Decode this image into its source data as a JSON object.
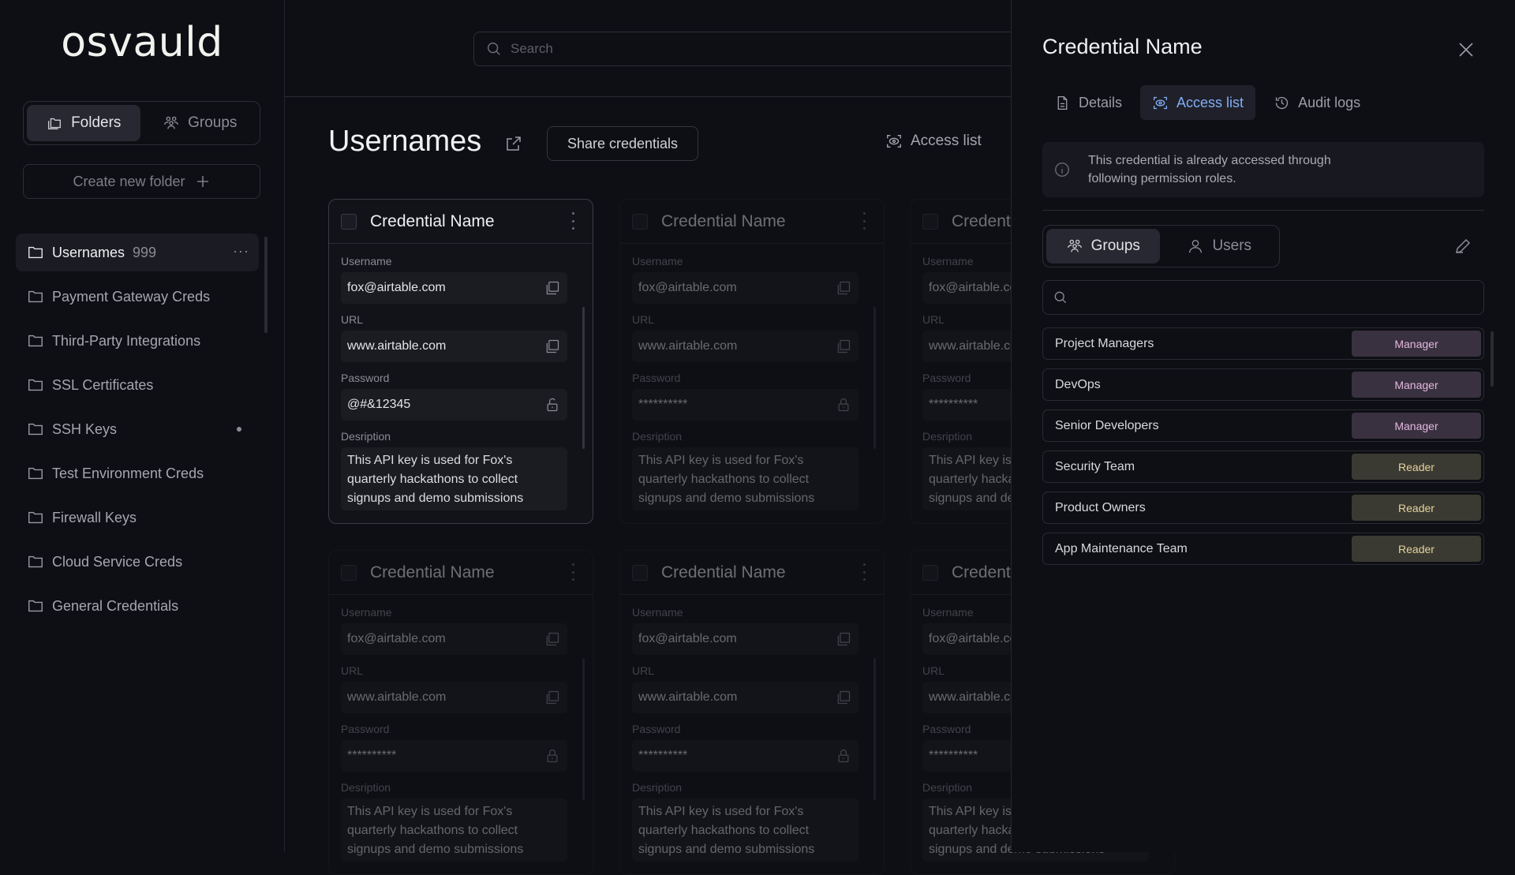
{
  "app": {
    "logo": "osvauld"
  },
  "sidebar": {
    "toggle": {
      "folders": "Folders",
      "groups": "Groups",
      "active": "folders"
    },
    "create_folder": "Create new folder",
    "folders": [
      {
        "name": "Usernames",
        "count": "999",
        "active": true,
        "more": "···"
      },
      {
        "name": "Payment Gateway Creds"
      },
      {
        "name": "Third-Party Integrations"
      },
      {
        "name": "SSL Certificates"
      },
      {
        "name": "SSH Keys",
        "indicator": true
      },
      {
        "name": "Test Environment Creds"
      },
      {
        "name": "Firewall Keys"
      },
      {
        "name": "Cloud Service Creds"
      },
      {
        "name": "General Credentials"
      }
    ]
  },
  "main": {
    "search_placeholder": "Search",
    "title": "Usernames",
    "share_button": "Share credentials",
    "access_list": "Access list",
    "cards": [
      {
        "title": "Credential Name",
        "username_label": "Username",
        "username": "fox@airtable.com",
        "url_label": "URL",
        "url": "www.airtable.com",
        "password_label": "Password",
        "password": "@#&12345",
        "description_label": "Desription",
        "description": "This API key is used for Fox's quarterly hackathons to collect signups and demo submissions",
        "state": "active"
      },
      {
        "title": "Credential Name",
        "username_label": "Username",
        "username": "fox@airtable.com",
        "url_label": "URL",
        "url": "www.airtable.com",
        "password_label": "Password",
        "password": "**********",
        "description_label": "Desription",
        "description": "This API key is used for Fox's quarterly hackathons to collect signups and demo submissions",
        "state": "dim"
      },
      {
        "title": "Credential Name",
        "username_label": "Username",
        "username": "fox@airtable.com",
        "url_label": "URL",
        "url": "www.airtable.com",
        "password_label": "Password",
        "password": "**********",
        "description_label": "Desription",
        "description": "This API key is used for Fox's quarterly hackathons to collect signups and demo submissions",
        "state": "dim"
      },
      {
        "title": "Credential Name",
        "username_label": "Username",
        "username": "fox@airtable.com",
        "url_label": "URL",
        "url": "www.airtable.com",
        "password_label": "Password",
        "password": "**********",
        "description_label": "Desription",
        "description": "This API key is used for Fox's quarterly hackathons to collect signups and demo submissions",
        "state": "dim"
      },
      {
        "title": "Credential Name",
        "username_label": "Username",
        "username": "fox@airtable.com",
        "url_label": "URL",
        "url": "www.airtable.com",
        "password_label": "Password",
        "password": "**********",
        "description_label": "Desription",
        "description": "This API key is used for Fox's quarterly hackathons to collect signups and demo submissions",
        "state": "dim"
      },
      {
        "title": "Credential Name",
        "username_label": "Username",
        "username": "fox@airtable.com",
        "url_label": "URL",
        "url": "www.airtable.com",
        "password_label": "Password",
        "password": "**********",
        "description_label": "Desription",
        "description": "This API key is used for Fox's quarterly hackathons to collect signups and demo submissions",
        "state": "dim"
      }
    ]
  },
  "panel": {
    "title": "Credential Name",
    "tabs": {
      "details": "Details",
      "access_list": "Access list",
      "audit_logs": "Audit logs",
      "active": "access_list"
    },
    "info": "This credential is already accessed through following permission roles.",
    "toggle": {
      "groups": "Groups",
      "users": "Users",
      "active": "groups"
    },
    "search_value": "",
    "rows": [
      {
        "name": "Project Managers",
        "role": "Manager"
      },
      {
        "name": "DevOps",
        "role": "Manager"
      },
      {
        "name": "Senior Developers",
        "role": "Manager"
      },
      {
        "name": "Security Team",
        "role": "Reader"
      },
      {
        "name": "Product Owners",
        "role": "Reader"
      },
      {
        "name": "App Maintenance Team",
        "role": "Reader"
      }
    ],
    "colors": {
      "accent": "#83aef5",
      "manager_bg": "#3a3140",
      "manager_text": "#e2b8df",
      "reader_bg": "#3b3a32",
      "reader_text": "#e5d29d"
    }
  }
}
